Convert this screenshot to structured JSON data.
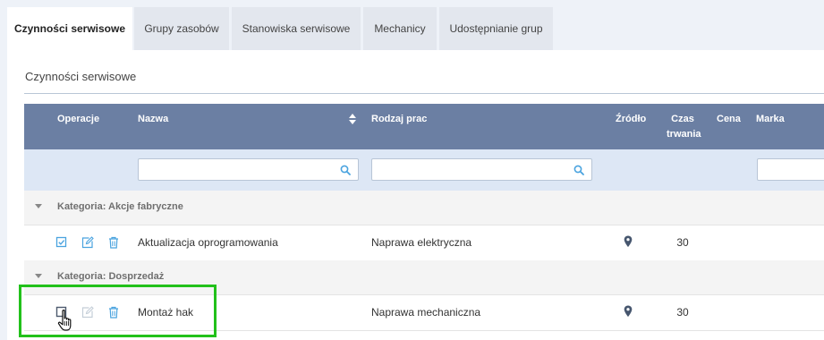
{
  "tabs": [
    {
      "label": "Czynności serwisowe",
      "active": true
    },
    {
      "label": "Grupy zasobów",
      "active": false
    },
    {
      "label": "Stanowiska serwisowe",
      "active": false
    },
    {
      "label": "Mechanicy",
      "active": false
    },
    {
      "label": "Udostępnianie grup",
      "active": false
    }
  ],
  "section_title": "Czynności serwisowe",
  "columns": {
    "operacje": "Operacje",
    "nazwa": "Nazwa",
    "rodzaj_prac": "Rodzaj prac",
    "zrodlo": "Źródło",
    "czas_trwania_line1": "Czas",
    "czas_trwania_line2": "trwania",
    "cena": "Cena",
    "marka": "Marka"
  },
  "filters": {
    "nazwa": "",
    "rodzaj_prac": "",
    "marka": ""
  },
  "groups": [
    {
      "category": "Kategoria: Akcje fabryczne",
      "rows": [
        {
          "nazwa": "Aktualizacja oprogramowania",
          "rodzaj_prac": "Naprawa elektryczna",
          "czas": "30",
          "checked": true
        }
      ]
    },
    {
      "category": "Kategoria: Dosprzedaż",
      "rows": [
        {
          "nazwa": "Montaż hak",
          "rodzaj_prac": "Naprawa mechaniczna",
          "czas": "30",
          "checked": false
        }
      ]
    }
  ],
  "colors": {
    "header": "#6b7fa3",
    "filter_row": "#dde7f5",
    "icon": "#4aa3df",
    "highlight": "#22c11b",
    "pin": "#46566e"
  },
  "icons": {
    "sort": "sort-icon",
    "search": "search-icon",
    "caret": "caret-down-icon",
    "check": "checkbox-icon",
    "edit": "edit-icon",
    "delete": "trash-icon",
    "pin": "map-pin-icon",
    "cursor": "hand-cursor-icon"
  }
}
